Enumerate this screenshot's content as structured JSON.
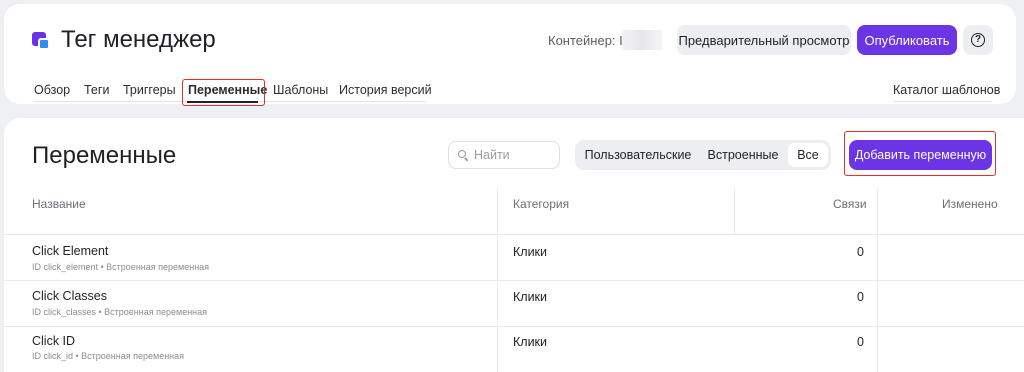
{
  "header": {
    "app_title": "Тег менеджер",
    "container_label": "Контейнер: ID",
    "preview_button": "Предварительный просмотр",
    "publish_button": "Опубликовать",
    "help_icon": "help-circle-icon",
    "help_symbol": "?"
  },
  "tabs": [
    {
      "label": "Обзор"
    },
    {
      "label": "Теги"
    },
    {
      "label": "Триггеры"
    },
    {
      "label": "Переменные",
      "active": true
    },
    {
      "label": "Шаблоны"
    },
    {
      "label": "История версий"
    }
  ],
  "catalog_link": "Каталог шаблонов",
  "page": {
    "title": "Переменные",
    "search_placeholder": "Найти",
    "filters": [
      {
        "label": "Пользовательские"
      },
      {
        "label": "Встроенные"
      },
      {
        "label": "Все",
        "active": true
      }
    ],
    "add_button": "Добавить переменную"
  },
  "table": {
    "columns": [
      "Название",
      "Категория",
      "Связи",
      "Изменено"
    ],
    "rows": [
      {
        "name": "Click Element",
        "sub": "ID click_element • Встроенная переменная",
        "category": "Клики",
        "links": "0"
      },
      {
        "name": "Click Classes",
        "sub": "ID click_classes • Встроенная переменная",
        "category": "Клики",
        "links": "0"
      },
      {
        "name": "Click ID",
        "sub": "ID click_id • Встроенная переменная",
        "category": "Клики",
        "links": "0"
      }
    ]
  },
  "colors": {
    "accent": "#6b35e6",
    "highlight": "#e0302f",
    "logo_primary": "#6a32e8",
    "logo_secondary": "#2f8cf3"
  }
}
